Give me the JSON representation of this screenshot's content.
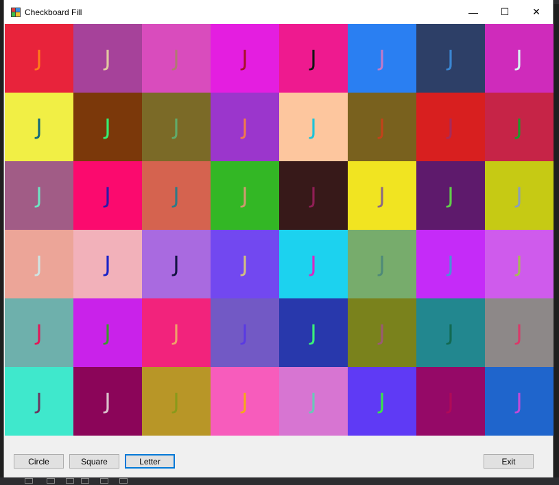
{
  "window": {
    "title": "Checkboard Fill",
    "minimize_glyph": "—",
    "maximize_glyph": "☐",
    "close_glyph": "✕"
  },
  "grid": {
    "rows": 6,
    "cols": 8,
    "cells": [
      [
        {
          "bg": "#e8233b",
          "fg": "#ff7a1a",
          "ch": "J"
        },
        {
          "bg": "#a6429a",
          "fg": "#e2c7a0",
          "ch": "J"
        },
        {
          "bg": "#d94cbd",
          "fg": "#b07a72",
          "ch": "J"
        },
        {
          "bg": "#e41ee0",
          "fg": "#a8102b",
          "ch": "J"
        },
        {
          "bg": "#ee1a8f",
          "fg": "#141414",
          "ch": "J"
        },
        {
          "bg": "#2a7ff2",
          "fg": "#c07ac8",
          "ch": "J"
        },
        {
          "bg": "#2d3f67",
          "fg": "#3a86d2",
          "ch": "J"
        },
        {
          "bg": "#cf2bbb",
          "fg": "#d8f2f2",
          "ch": "J"
        }
      ],
      [
        {
          "bg": "#f1ef45",
          "fg": "#146a78",
          "ch": "J"
        },
        {
          "bg": "#7b380a",
          "fg": "#34f071",
          "ch": "J"
        },
        {
          "bg": "#7b6a27",
          "fg": "#62aa6a",
          "ch": "J"
        },
        {
          "bg": "#9b36cc",
          "fg": "#f07a4a",
          "ch": "J"
        },
        {
          "bg": "#fdc69e",
          "fg": "#1ec3d8",
          "ch": "J"
        },
        {
          "bg": "#79611e",
          "fg": "#c2421a",
          "ch": "J"
        },
        {
          "bg": "#d81f1f",
          "fg": "#a82a5a",
          "ch": "J"
        },
        {
          "bg": "#c62447",
          "fg": "#1b9a2a",
          "ch": "J"
        }
      ],
      [
        {
          "bg": "#a15c86",
          "fg": "#6fe2c2",
          "ch": "J"
        },
        {
          "bg": "#fb0a6e",
          "fg": "#2a1aa8",
          "ch": "J"
        },
        {
          "bg": "#d5634f",
          "fg": "#2f7a86",
          "ch": "J"
        },
        {
          "bg": "#33b725",
          "fg": "#cf9a70",
          "ch": "J"
        },
        {
          "bg": "#371919",
          "fg": "#8f1f55",
          "ch": "J"
        },
        {
          "bg": "#f1e421",
          "fg": "#8c6a84",
          "ch": "J"
        },
        {
          "bg": "#5e1a6c",
          "fg": "#62ce4a",
          "ch": "J"
        },
        {
          "bg": "#c6ca14",
          "fg": "#8aa0b8",
          "ch": "J"
        }
      ],
      [
        {
          "bg": "#eca598",
          "fg": "#cfe3e2",
          "ch": "J"
        },
        {
          "bg": "#f2b1ba",
          "fg": "#1a22c8",
          "ch": "J"
        },
        {
          "bg": "#a96ae0",
          "fg": "#141444",
          "ch": "J"
        },
        {
          "bg": "#7248f0",
          "fg": "#d2c080",
          "ch": "J"
        },
        {
          "bg": "#1cd2ef",
          "fg": "#d82ac2",
          "ch": "J"
        },
        {
          "bg": "#77ac6c",
          "fg": "#4f8a78",
          "ch": "J"
        },
        {
          "bg": "#c52bf8",
          "fg": "#4a90d8",
          "ch": "J"
        },
        {
          "bg": "#cf5bec",
          "fg": "#a8b858",
          "ch": "J"
        }
      ],
      [
        {
          "bg": "#6eb0ac",
          "fg": "#e01a5a",
          "ch": "J"
        },
        {
          "bg": "#c922ea",
          "fg": "#3a9a2a",
          "ch": "J"
        },
        {
          "bg": "#f2237c",
          "fg": "#f0a06a",
          "ch": "J"
        },
        {
          "bg": "#7259c5",
          "fg": "#5a3ae2",
          "ch": "J"
        },
        {
          "bg": "#2838ac",
          "fg": "#3af07a",
          "ch": "J"
        },
        {
          "bg": "#7a821c",
          "fg": "#9a5a72",
          "ch": "J"
        },
        {
          "bg": "#22878f",
          "fg": "#126a52",
          "ch": "J"
        },
        {
          "bg": "#8d8888",
          "fg": "#d83a6a",
          "ch": "J"
        }
      ],
      [
        {
          "bg": "#3fe8cc",
          "fg": "#6a3a62",
          "ch": "J"
        },
        {
          "bg": "#8b0559",
          "fg": "#dac2cc",
          "ch": "J"
        },
        {
          "bg": "#b89627",
          "fg": "#8a9a1a",
          "ch": "J"
        },
        {
          "bg": "#f75cbc",
          "fg": "#f6a81a",
          "ch": "J"
        },
        {
          "bg": "#d775d2",
          "fg": "#6ac8b8",
          "ch": "J"
        },
        {
          "bg": "#5f3af5",
          "fg": "#3ae24a",
          "ch": "J"
        },
        {
          "bg": "#950967",
          "fg": "#b00a58",
          "ch": "J"
        },
        {
          "bg": "#1f65cc",
          "fg": "#c04ad8",
          "ch": "J"
        }
      ]
    ]
  },
  "buttons": {
    "circle": "Circle",
    "square": "Square",
    "letter": "Letter",
    "exit": "Exit"
  }
}
